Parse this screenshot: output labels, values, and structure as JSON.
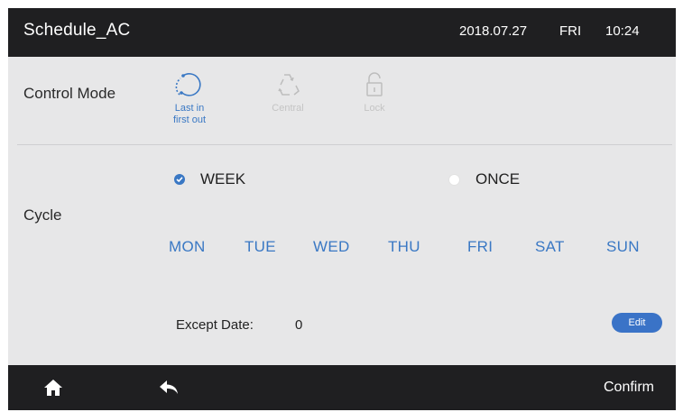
{
  "header": {
    "title": "Schedule_AC",
    "date": "2018.07.27",
    "weekday": "FRI",
    "time": "10:24"
  },
  "control_mode": {
    "label": "Control Mode",
    "options": [
      {
        "line1": "Last in",
        "line2": "first out",
        "icon": "circular-arrows-icon",
        "active": true
      },
      {
        "line1": "Central",
        "line2": "",
        "icon": "recycle-arrows-icon",
        "active": false
      },
      {
        "line1": "Lock",
        "line2": "",
        "icon": "lock-icon",
        "active": false
      }
    ]
  },
  "cycle": {
    "label": "Cycle",
    "options": [
      {
        "label": "WEEK",
        "selected": true
      },
      {
        "label": "ONCE",
        "selected": false
      }
    ],
    "days": [
      "MON",
      "TUE",
      "WED",
      "THU",
      "FRI",
      "SAT",
      "SUN"
    ]
  },
  "except": {
    "label": "Except Date:",
    "value": "0",
    "edit_label": "Edit"
  },
  "footer": {
    "home_icon": "home-icon",
    "back_icon": "back-arrow-icon",
    "confirm_label": "Confirm"
  },
  "colors": {
    "accent": "#3a78c4",
    "bar": "#1f1f21",
    "panel": "#e7e7e8",
    "inactive": "#c4c4c4"
  }
}
